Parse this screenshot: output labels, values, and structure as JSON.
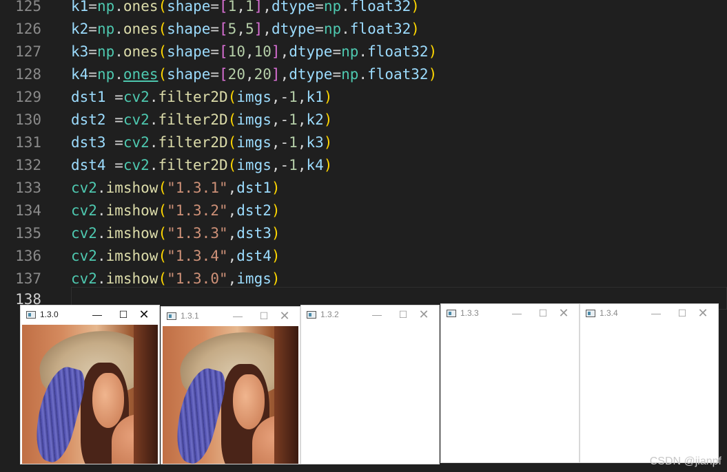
{
  "editor": {
    "lines": [
      {
        "num": "125",
        "text": "k1=np.ones(shape=[1,1],dtype=np.float32)"
      },
      {
        "num": "126",
        "text": "k2=np.ones(shape=[5,5],dtype=np.float32)"
      },
      {
        "num": "127",
        "text": "k3=np.ones(shape=[10,10],dtype=np.float32)"
      },
      {
        "num": "128",
        "text": "k4=np.ones(shape=[20,20],dtype=np.float32)"
      },
      {
        "num": "129",
        "text": "dst1 =cv2.filter2D(imgs,-1,k1)"
      },
      {
        "num": "130",
        "text": "dst2 =cv2.filter2D(imgs,-1,k2)"
      },
      {
        "num": "131",
        "text": "dst3 =cv2.filter2D(imgs,-1,k3)"
      },
      {
        "num": "132",
        "text": "dst4 =cv2.filter2D(imgs,-1,k4)"
      },
      {
        "num": "133",
        "text": "cv2.imshow(\"1.3.1\",dst1)"
      },
      {
        "num": "134",
        "text": "cv2.imshow(\"1.3.2\",dst2)"
      },
      {
        "num": "135",
        "text": "cv2.imshow(\"1.3.3\",dst3)"
      },
      {
        "num": "136",
        "text": "cv2.imshow(\"1.3.4\",dst4)"
      },
      {
        "num": "137",
        "text": "cv2.imshow(\"1.3.0\",imgs)"
      },
      {
        "num": "138",
        "text": ""
      }
    ]
  },
  "windows": [
    {
      "title": "1.3.0",
      "active": true
    },
    {
      "title": "1.3.1",
      "active": false
    },
    {
      "title": "1.3.2",
      "active": false
    },
    {
      "title": "1.3.3",
      "active": false
    },
    {
      "title": "1.3.4",
      "active": false
    }
  ],
  "window_controls": {
    "minimize": "—",
    "maximize": "☐",
    "close": "✕"
  },
  "watermark": "CSDN @jianpf",
  "colors": {
    "editor_bg": "#1f1f1f",
    "line_number": "#8a8a8a",
    "variable": "#9cdcfe",
    "module": "#4ec9b0",
    "function": "#dcdcaa",
    "bracket1": "#ffd700",
    "bracket2": "#da70d6",
    "number": "#b5cea8",
    "string": "#ce9178"
  }
}
